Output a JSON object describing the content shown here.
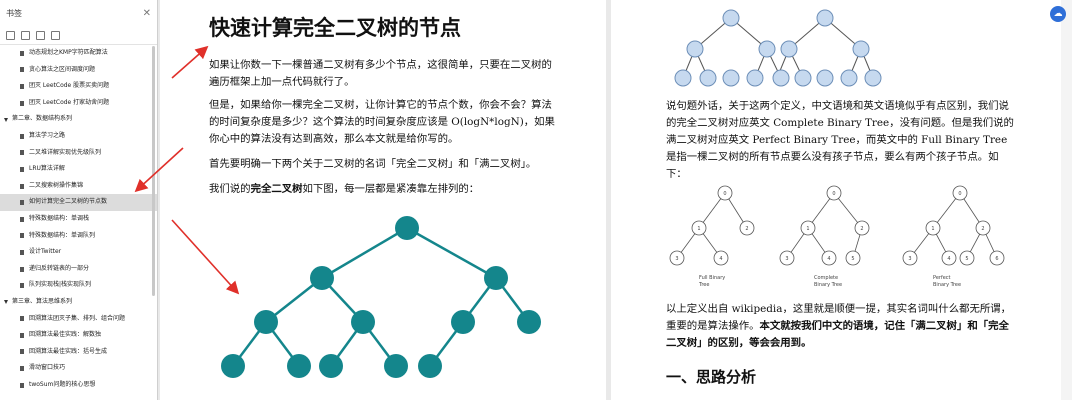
{
  "sidebar": {
    "title": "书签",
    "items": [
      {
        "label": "动态规划之KMP字符匹配算法",
        "level": 1
      },
      {
        "label": "贪心算法之区间调度问题",
        "level": 1
      },
      {
        "label": "团灭 LeetCode 股票买卖问题",
        "level": 1
      },
      {
        "label": "团灭 LeetCode 打家劫舍问题",
        "level": 1
      },
      {
        "label": "第二章、数据结构系列",
        "level": 0
      },
      {
        "label": "算法学习之路",
        "level": 1
      },
      {
        "label": "二叉堆详解实现优先级队列",
        "level": 1
      },
      {
        "label": "LRU算法详解",
        "level": 1
      },
      {
        "label": "二叉搜索树操作集锦",
        "level": 1
      },
      {
        "label": "如何计算完全二叉树的节点数",
        "level": 1,
        "active": true
      },
      {
        "label": "特殊数据结构：单调栈",
        "level": 1
      },
      {
        "label": "特殊数据结构：单调队列",
        "level": 1
      },
      {
        "label": "设计Twitter",
        "level": 1
      },
      {
        "label": "递归反转链表的一部分",
        "level": 1
      },
      {
        "label": "队列实现栈|栈实现队列",
        "level": 1
      },
      {
        "label": "第三章、算法思维系列",
        "level": 0
      },
      {
        "label": "回溯算法团灭子集、排列、组合问题",
        "level": 1
      },
      {
        "label": "回溯算法最佳实践：解数独",
        "level": 1
      },
      {
        "label": "回溯算法最佳实践：括号生成",
        "level": 1
      },
      {
        "label": "滑动窗口技巧",
        "level": 1
      },
      {
        "label": "twoSum问题的核心思想",
        "level": 1
      }
    ]
  },
  "left_page": {
    "title": "快速计算完全二叉树的节点",
    "p1": "如果让你数一下一棵普通二叉树有多少个节点，这很简单，只要在二叉树的遍历框架上加一点代码就行了。",
    "p2": "但是，如果给你一棵完全二叉树，让你计算它的节点个数，你会不会？算法的时间复杂度是多少？这个算法的时间复杂度应该是 O(logN*logN)，如果你心中的算法没有达到高效，那么本文就是给你写的。",
    "p3": "首先要明确一下两个关于二叉树的名词「完全二叉树」和「满二叉树」。",
    "p4_pre": "我们说的",
    "p4_bold": "完全二叉树",
    "p4_post": "如下图，每一层都是紧凑靠左排列的："
  },
  "right_page": {
    "p1": "说句题外话，关于这两个定义，中文语境和英文语境似乎有点区别，我们说的完全二叉树对应英文 Complete Binary Tree，没有问题。但是我们说的满二叉树对应英文 Perfect Binary Tree，而英文中的 Full Binary Tree 是指一棵二叉树的所有节点要么没有孩子节点，要么有两个孩子节点。如下：",
    "fig_labels": [
      "Full Binary Tree",
      "Complete Binary Tree",
      "Perfect Binary Tree"
    ],
    "p2_pre": "以上定义出自 wikipedia，这里就是顺便一提，其实名词叫什么都无所谓，重要的是算法操作。",
    "p2_bold": "本文就按我们中文的语境，记住「满二叉树」和「完全二叉树」的区别，等会会用到。",
    "h2": "一、思路分析"
  },
  "colors": {
    "tree_fill": "#14868c",
    "tree_light": "#c6d9ef",
    "arrow": "#e0302a",
    "active_bg": "#dcdcdc"
  },
  "badge_icon": "cloud-sync-icon"
}
